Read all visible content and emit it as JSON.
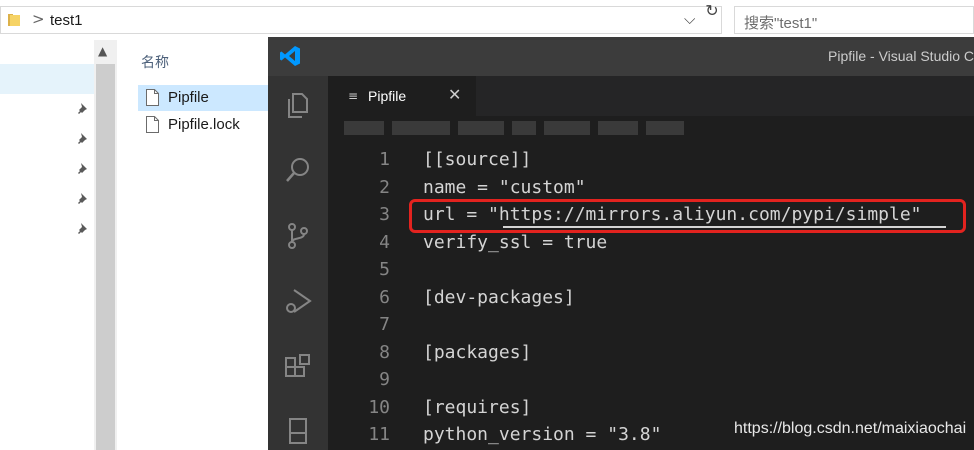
{
  "explorer": {
    "breadcrumb": {
      "chevron": ">",
      "folder": "test1"
    },
    "address_dropdown_glyph": "⌵",
    "refresh_glyph": "↻",
    "search_placeholder": "搜索\"test1\"",
    "column_header": "名称",
    "files": [
      {
        "name": "Pipfile",
        "selected": true
      },
      {
        "name": "Pipfile.lock",
        "selected": false
      }
    ],
    "nav_scroll_up_glyph": "▲",
    "pinned_icons": [
      "pin-icon",
      "pin-icon",
      "pin-icon",
      "pin-icon",
      "pin-icon"
    ]
  },
  "vscode": {
    "window_title": "Pipfile - Visual Studio Code",
    "activity_icons": [
      "explorer-icon",
      "search-icon",
      "source-control-icon",
      "run-debug-icon",
      "extensions-icon",
      "remote-icon"
    ],
    "tab": {
      "glyph": "≡",
      "label": "Pipfile",
      "close_glyph": "✕"
    },
    "lines": [
      {
        "n": "1",
        "text": "[[source]]"
      },
      {
        "n": "2",
        "text": "name = \"custom\""
      },
      {
        "n": "3",
        "text": "url = \"https://mirrors.aliyun.com/pypi/simple\""
      },
      {
        "n": "4",
        "text": "verify_ssl = true"
      },
      {
        "n": "5",
        "text": ""
      },
      {
        "n": "6",
        "text": "[dev-packages]"
      },
      {
        "n": "7",
        "text": ""
      },
      {
        "n": "8",
        "text": "[packages]"
      },
      {
        "n": "9",
        "text": ""
      },
      {
        "n": "10",
        "text": "[requires]"
      },
      {
        "n": "11",
        "text": "python_version = \"3.8\""
      }
    ]
  },
  "watermark": "https://blog.csdn.net/maixiaochai",
  "colors": {
    "highlight_box": "#e3231f",
    "vscode_blue": "#0098ff",
    "editor_bg": "#1e1e1e",
    "titlebar_bg": "#3c3c3c",
    "activity_bg": "#333333"
  }
}
